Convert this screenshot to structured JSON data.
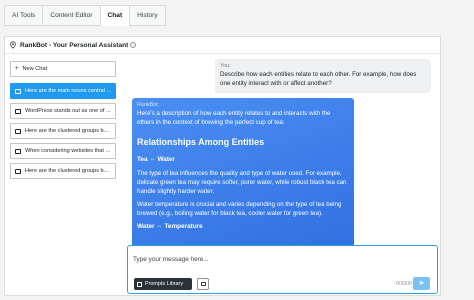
{
  "tabs": [
    {
      "label": "AI Tools"
    },
    {
      "label": "Content Editor"
    },
    {
      "label": "Chat"
    },
    {
      "label": "History"
    }
  ],
  "active_tab": "Chat",
  "panel": {
    "title": "RankBot - Your Personal Assistant",
    "info_icon": "i"
  },
  "sidebar": {
    "new_chat": "New Chat",
    "items": [
      {
        "label": "Here are the main nouns central ..."
      },
      {
        "label": "WordPress stands out as one of ..."
      },
      {
        "label": "Here are the clustered groups b..."
      },
      {
        "label": "When considering websites that ..."
      },
      {
        "label": "Here are the clustered groups b..."
      }
    ]
  },
  "chat": {
    "user_label": "You:",
    "user_text": "Describe how each entities relate to each other. For example, how does one entity interact with or affect another?",
    "bot_label": "RankBot:",
    "bot_intro": "Here's a description of how each entity relates to and interacts with the others in the context of brewing the perfect cup of tea:",
    "bot_heading": "Relationships Among Entities",
    "sub1": "Tea ⇔ Water",
    "p1": "The type of tea influences the quality and type of water used. For example, delicate green tea may require softer, purer water, while robust black tea can handle slightly harder water.",
    "p2": "Water temperature is crucial and varies depending on the type of tea being brewed (e.g., boiling water for black tea, cooler water for green tea).",
    "sub2": "Water ⇔ Temperature"
  },
  "composer": {
    "placeholder": "Type your message here...",
    "prompts_label": "Prompts Library",
    "counter": "0/2000",
    "send_icon": "➤"
  },
  "colors": {
    "accent": "#1e9bf0",
    "bot_bubble": "#3a7ee8",
    "send": "#7cc1f4"
  },
  "icons": {
    "pin": "pin-icon",
    "plus": "plus-icon",
    "doc": "doc-icon",
    "book": "book-icon",
    "send": "send-icon"
  }
}
